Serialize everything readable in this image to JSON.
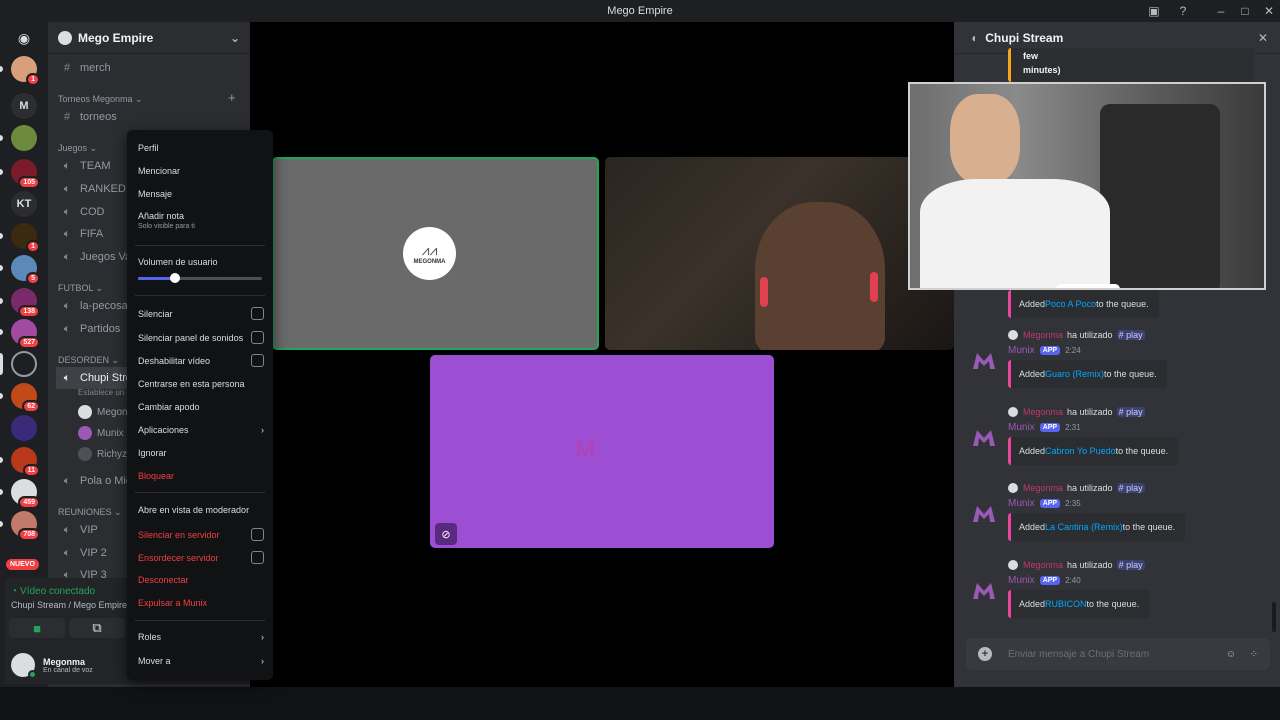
{
  "window": {
    "title": "Mego Empire"
  },
  "guild_badges": [
    "1",
    "1",
    "105",
    "1",
    "5",
    "138",
    "527",
    "62",
    "11",
    "459",
    "708"
  ],
  "guild_labels": {
    "m": "M",
    "kt": "KT"
  },
  "nuevo": "NUEVO",
  "server": {
    "name": "Mego Empire"
  },
  "channels": [
    {
      "type": "text",
      "name": "merch"
    },
    {
      "type": "category",
      "name": "Torneos Megonma"
    },
    {
      "type": "text",
      "name": "torneos"
    },
    {
      "type": "category",
      "name": "Juegos"
    },
    {
      "type": "voice",
      "name": "TEAM"
    },
    {
      "type": "voice",
      "name": "RANKED"
    },
    {
      "type": "voice",
      "name": "COD"
    },
    {
      "type": "voice",
      "name": "FIFA"
    },
    {
      "type": "voice",
      "name": "Juegos Vari"
    },
    {
      "type": "category",
      "name": "FUTBOL"
    },
    {
      "type": "voice",
      "name": "la-pecosa"
    },
    {
      "type": "voice",
      "name": "Partidos"
    },
    {
      "type": "category",
      "name": "DESORDEN"
    },
    {
      "type": "voice",
      "name": "Chupi Strea"
    },
    {
      "type": "voice",
      "name": "Pola o Mier"
    },
    {
      "type": "category",
      "name": "REUNIONES"
    },
    {
      "type": "voice",
      "name": "VIP"
    },
    {
      "type": "voice",
      "name": "VIP 2"
    },
    {
      "type": "voice",
      "name": "VIP 3"
    }
  ],
  "voice_status_hint": "Establece un e",
  "voice_members": [
    "Megon",
    "Munix",
    "Richyz"
  ],
  "voice": {
    "status": "Vídeo conectado",
    "location": "Chupi Stream / Mego Empire"
  },
  "user": {
    "name": "Megonma",
    "status": "En canal de voz"
  },
  "tile_label": "MEGONMA",
  "context_menu": {
    "items": [
      {
        "label": "Perfil"
      },
      {
        "label": "Mencionar"
      },
      {
        "label": "Mensaje"
      },
      {
        "label": "Añadir nota",
        "hint": "Solo visible para ti"
      },
      {
        "label": "Volumen de usuario",
        "volume": 0.3
      },
      {
        "label": "Silenciar",
        "check": true
      },
      {
        "label": "Silenciar panel de sonidos",
        "check": true
      },
      {
        "label": "Deshabilitar vídeo",
        "check": true
      },
      {
        "label": "Centrarse en esta persona"
      },
      {
        "label": "Cambiar apodo"
      },
      {
        "label": "Aplicaciones",
        "arrow": true
      },
      {
        "label": "Ignorar"
      },
      {
        "label": "Bloquear",
        "danger": true
      },
      {
        "label": "Abre en vista de moderador"
      },
      {
        "label": "Silenciar en servidor",
        "danger": true,
        "check": true
      },
      {
        "label": "Ensordecer servidor",
        "danger": true,
        "check": true
      },
      {
        "label": "Desconectar",
        "danger": true
      },
      {
        "label": "Expulsar a Munix",
        "danger": true
      },
      {
        "label": "Roles",
        "arrow": true
      },
      {
        "label": "Mover a",
        "arrow": true
      }
    ]
  },
  "chat": {
    "title": "Chupi Stream",
    "top_snippet": [
      "few",
      "minutes)"
    ],
    "first_embed": {
      "prefix": "Added ",
      "song": "Poco A Poco",
      "suffix": " to the queue."
    },
    "messages": [
      {
        "reply_user": "Megonma",
        "reply_text": "ha utilizado",
        "cmd": "# play",
        "author": "Munix",
        "tag": "APP",
        "time": "2:24",
        "song": "Guaro (Remix)"
      },
      {
        "reply_user": "Megonma",
        "reply_text": "ha utilizado",
        "cmd": "# play",
        "author": "Munix",
        "tag": "APP",
        "time": "2:31",
        "song": "Cabron Yo Puedo"
      },
      {
        "reply_user": "Megonma",
        "reply_text": "ha utilizado",
        "cmd": "# play",
        "author": "Munix",
        "tag": "APP",
        "time": "2:35",
        "song": "La Cantina (Remix)"
      },
      {
        "reply_user": "Megonma",
        "reply_text": "ha utilizado",
        "cmd": "# play",
        "author": "Munix",
        "tag": "APP",
        "time": "2:40",
        "song": "RUBICON"
      }
    ],
    "added": "Added ",
    "to_queue": " to the queue.",
    "input_placeholder": "Enviar mensaje a Chupi Stream"
  },
  "colors": {
    "accent": "#5865f2",
    "danger": "#f23f43",
    "online": "#23a559",
    "munix": "#9b59b6",
    "tile_purple": "#9c4fd3"
  }
}
